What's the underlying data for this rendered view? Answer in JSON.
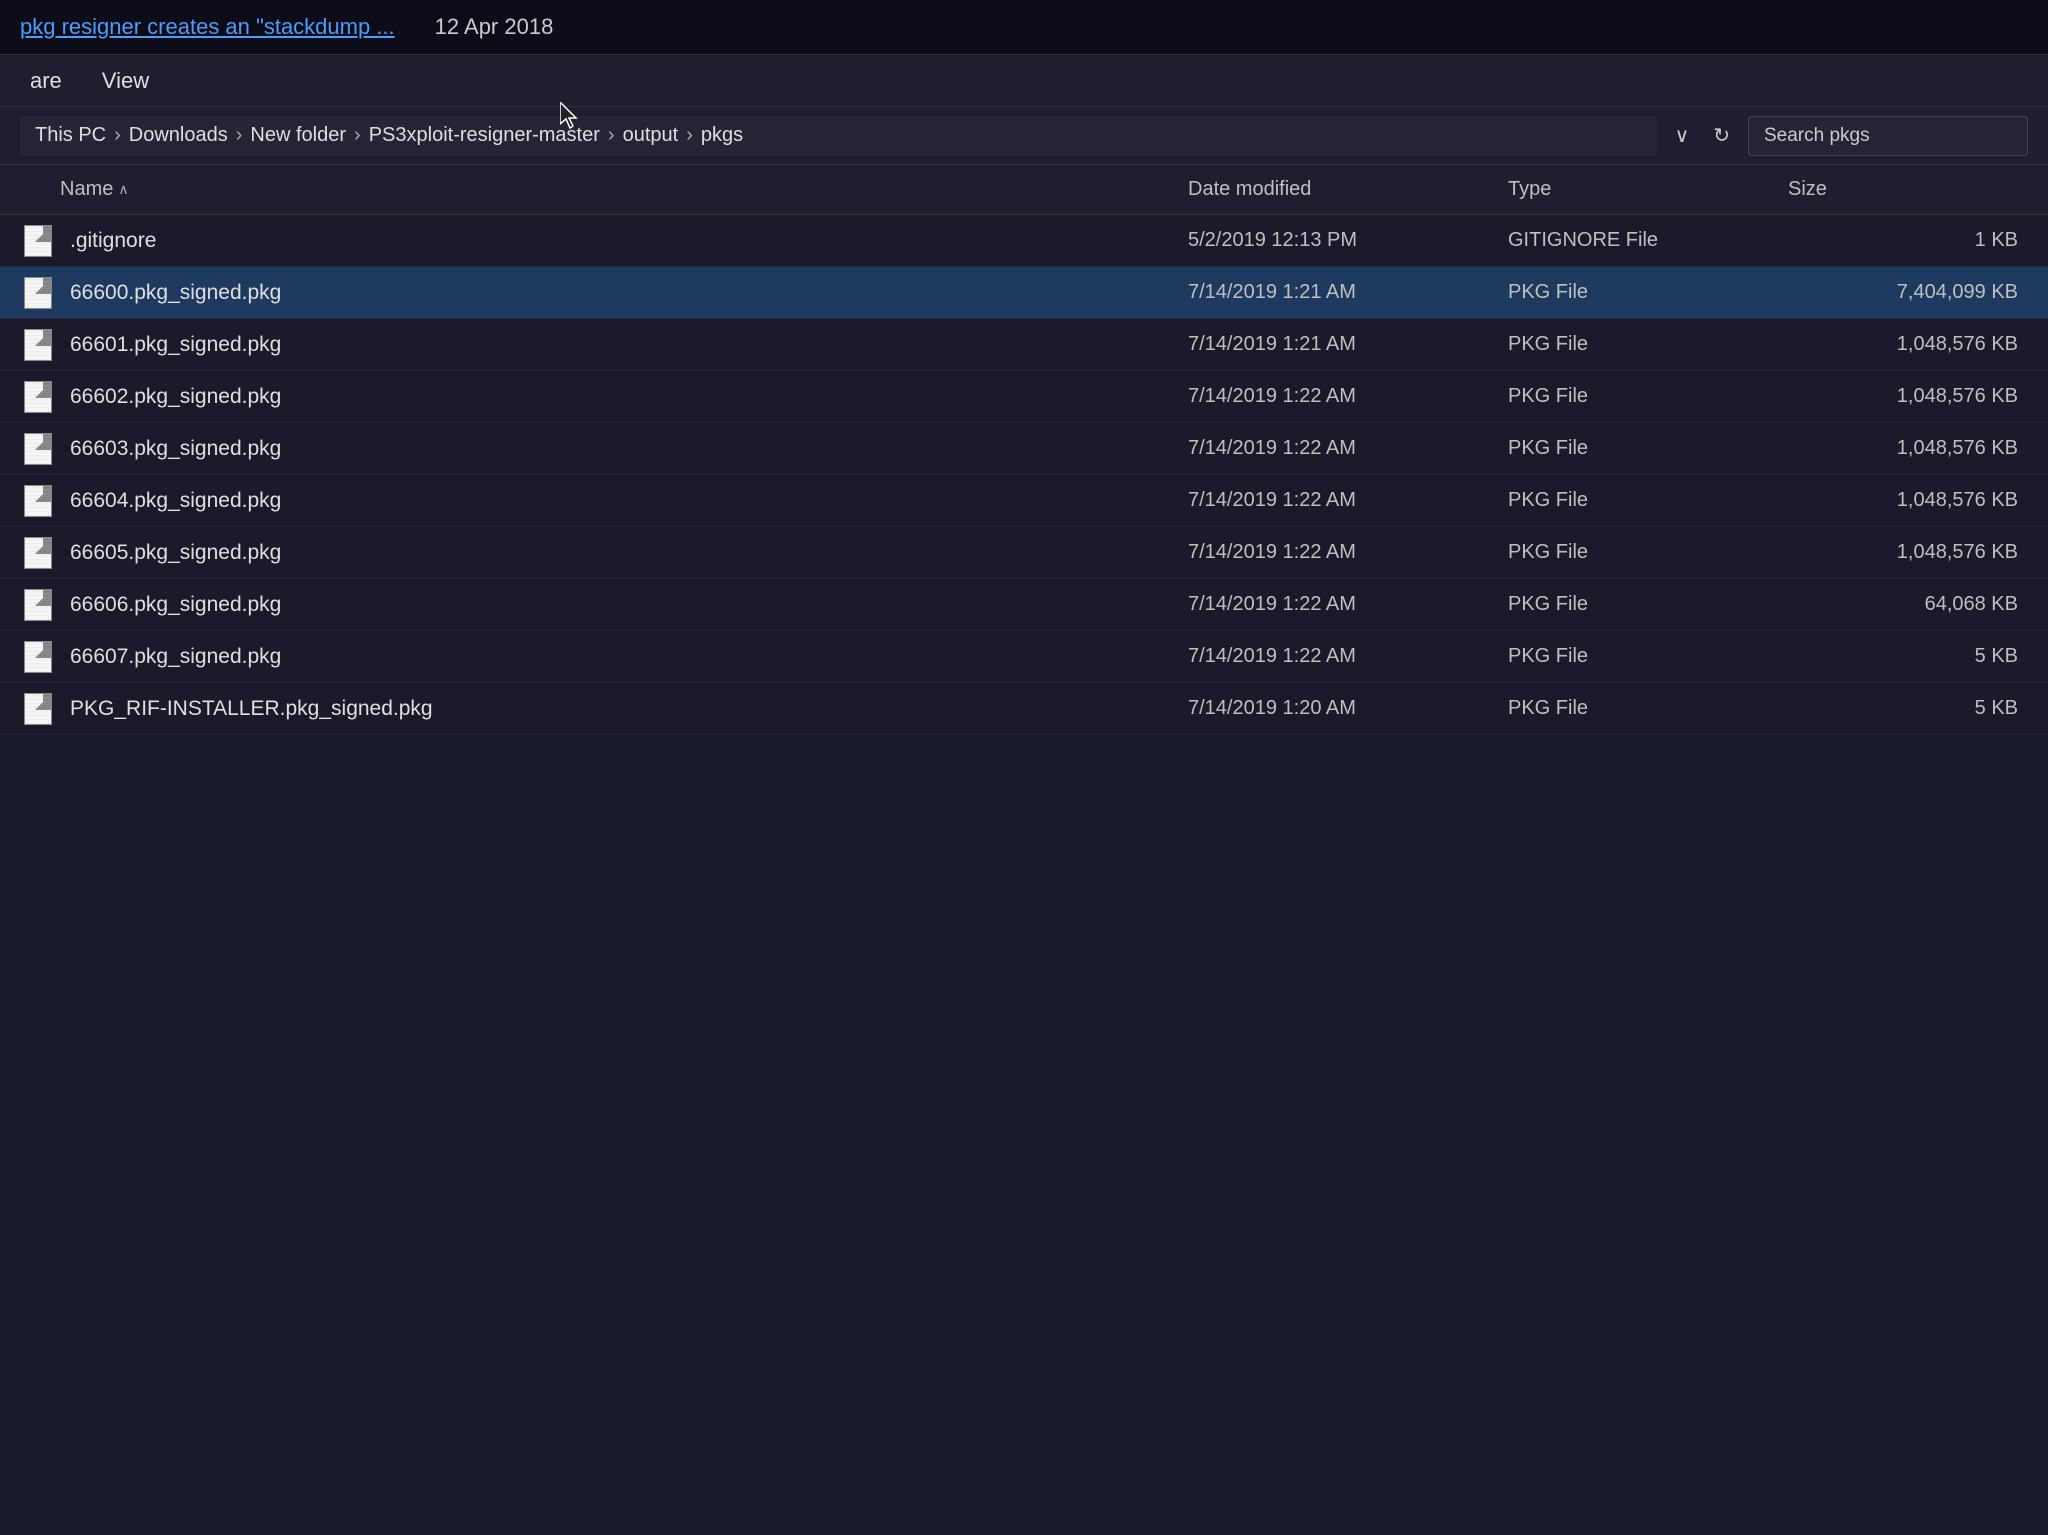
{
  "notification": {
    "text": "pkg resigner creates an \"stackdump ...",
    "date": "12 Apr 2018"
  },
  "menu": {
    "items": [
      "are",
      "View"
    ]
  },
  "addressbar": {
    "breadcrumbs": [
      {
        "label": "This PC"
      },
      {
        "label": "Downloads"
      },
      {
        "label": "New folder"
      },
      {
        "label": "PS3xploit-resigner-master"
      },
      {
        "label": "output"
      },
      {
        "label": "pkgs"
      }
    ],
    "search_placeholder": "Search pkgs"
  },
  "columns": {
    "name": "Name",
    "date_modified": "Date modified",
    "type": "Type",
    "size": "Size"
  },
  "files": [
    {
      "name": ".gitignore",
      "date": "5/2/2019 12:13 PM",
      "type": "GITIGNORE File",
      "size": "1 KB",
      "selected": false
    },
    {
      "name": "66600.pkg_signed.pkg",
      "date": "7/14/2019 1:21 AM",
      "type": "PKG File",
      "size": "7,404,099 KB",
      "selected": true
    },
    {
      "name": "66601.pkg_signed.pkg",
      "date": "7/14/2019 1:21 AM",
      "type": "PKG File",
      "size": "1,048,576 KB",
      "selected": false
    },
    {
      "name": "66602.pkg_signed.pkg",
      "date": "7/14/2019 1:22 AM",
      "type": "PKG File",
      "size": "1,048,576 KB",
      "selected": false
    },
    {
      "name": "66603.pkg_signed.pkg",
      "date": "7/14/2019 1:22 AM",
      "type": "PKG File",
      "size": "1,048,576 KB",
      "selected": false
    },
    {
      "name": "66604.pkg_signed.pkg",
      "date": "7/14/2019 1:22 AM",
      "type": "PKG File",
      "size": "1,048,576 KB",
      "selected": false
    },
    {
      "name": "66605.pkg_signed.pkg",
      "date": "7/14/2019 1:22 AM",
      "type": "PKG File",
      "size": "1,048,576 KB",
      "selected": false
    },
    {
      "name": "66606.pkg_signed.pkg",
      "date": "7/14/2019 1:22 AM",
      "type": "PKG File",
      "size": "64,068 KB",
      "selected": false
    },
    {
      "name": "66607.pkg_signed.pkg",
      "date": "7/14/2019 1:22 AM",
      "type": "PKG File",
      "size": "5 KB",
      "selected": false
    },
    {
      "name": "PKG_RIF-INSTALLER.pkg_signed.pkg",
      "date": "7/14/2019 1:20 AM",
      "type": "PKG File",
      "size": "5 KB",
      "selected": false
    }
  ]
}
